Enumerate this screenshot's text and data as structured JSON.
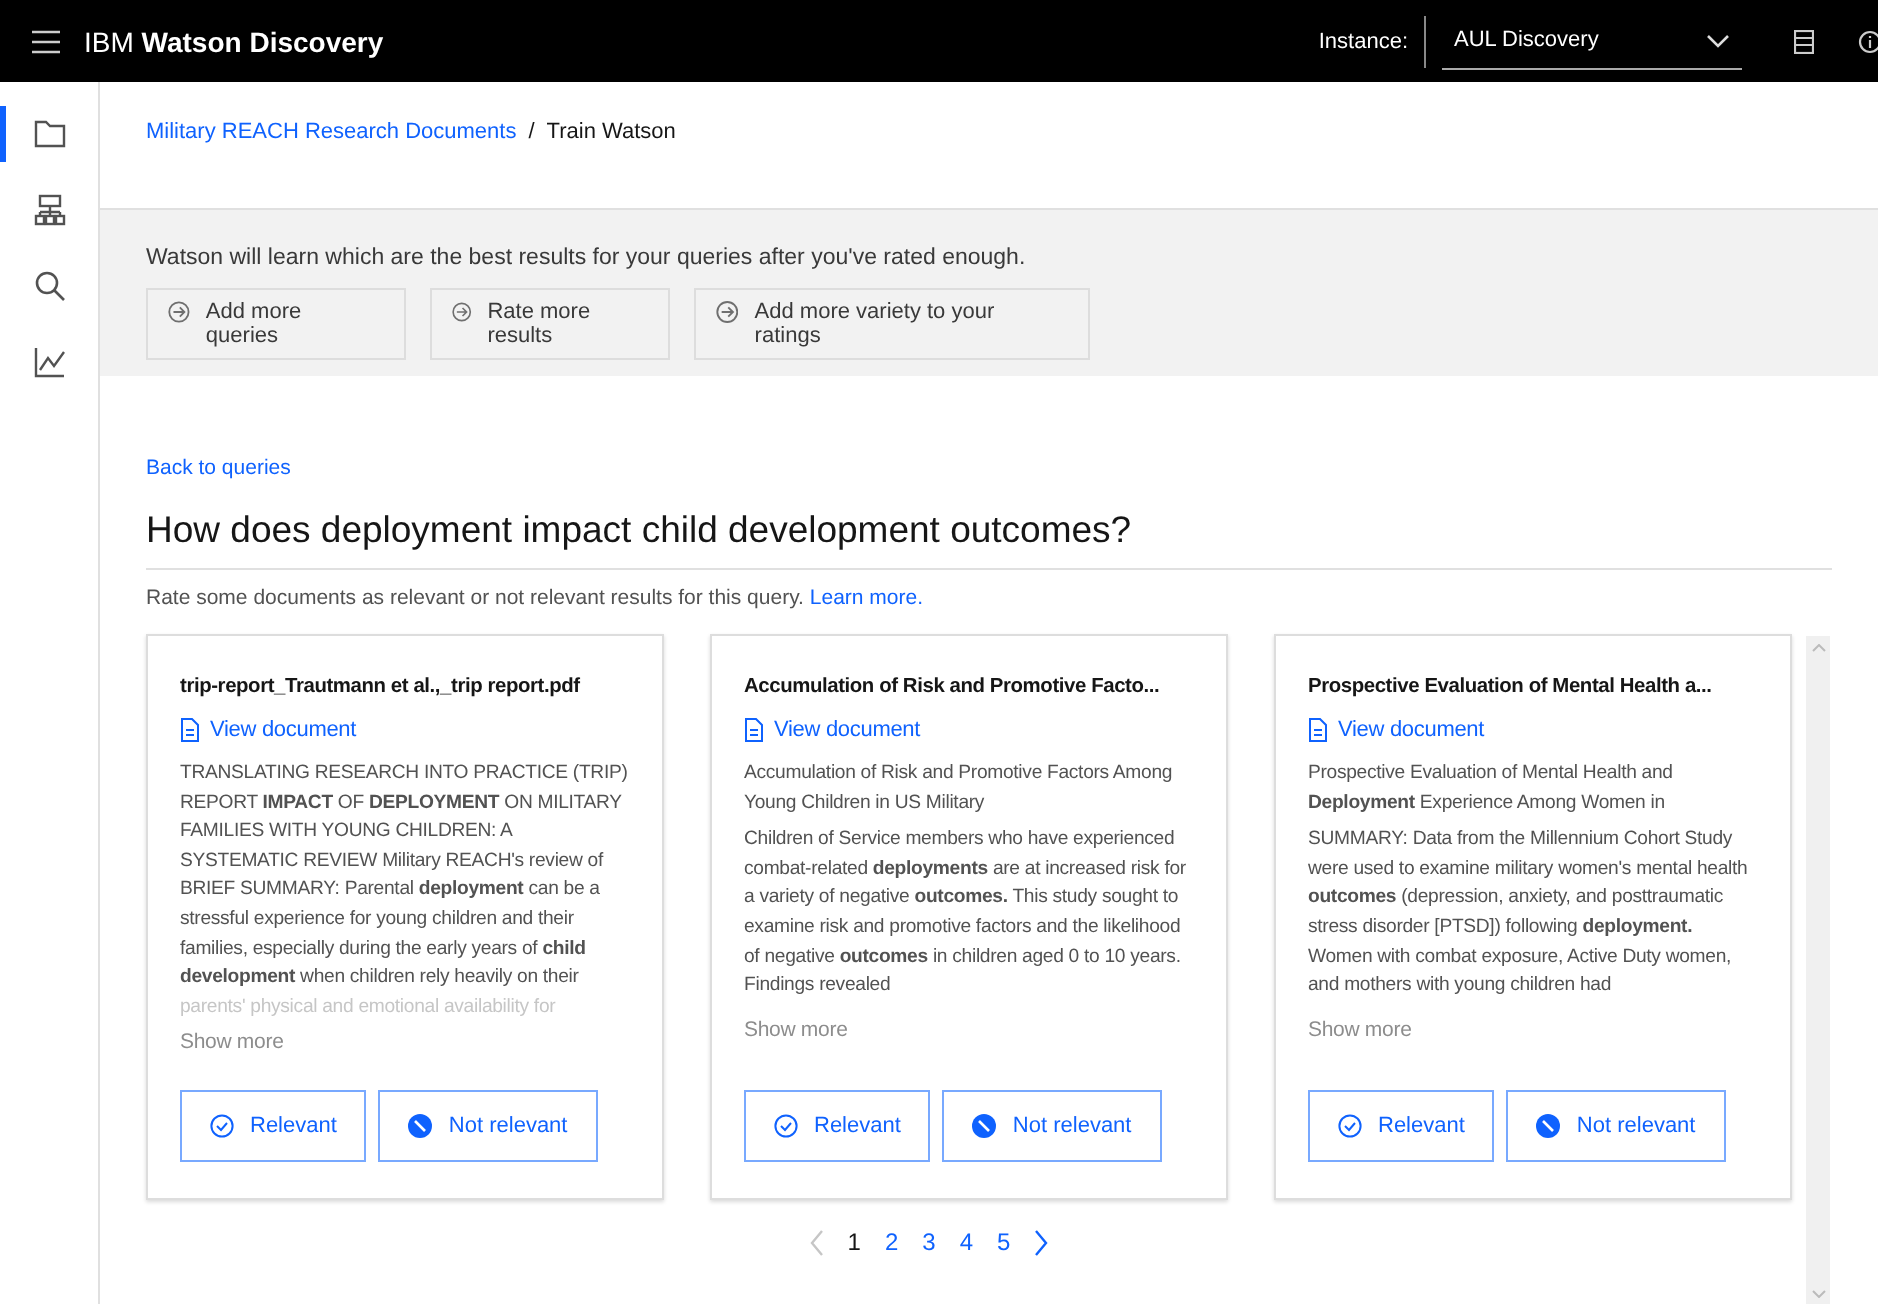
{
  "topbar": {
    "title": "IBM **Watson Discovery**",
    "instance_label": "Instance:",
    "instance_value": "AUL Discovery"
  },
  "rail": {
    "items": [
      {
        "kind": "folder",
        "selected": true
      },
      {
        "kind": "hierarchy",
        "selected": false
      },
      {
        "kind": "search",
        "selected": false
      },
      {
        "kind": "chart",
        "selected": false
      }
    ]
  },
  "breadcrumb": {
    "link": "Military REACH Research Documents",
    "separator": "/",
    "current": "Train Watson"
  },
  "banner": {
    "text": "Watson will learn which are the best results for your queries after you've rated enough.",
    "actions": [
      "Add more queries",
      "Rate more results",
      "Add more variety to your ratings"
    ]
  },
  "back_link": "Back to queries",
  "query": "How does deployment impact child development outcomes?",
  "instructions": {
    "text": "Rate some documents as relevant or not relevant results for this query.",
    "link": "Learn more."
  },
  "cards": [
    {
      "title": "trip-report_Trautmann et al.,_trip report.pdf",
      "link": "View document",
      "paragraphs": [
        "TRANSLATING RESEARCH INTO PRACTICE (TRIP) REPORT **IMPACT** OF **DEPLOYMENT** ON MILITARY FAMILIES WITH YOUNG CHILDREN: A SYSTEMATIC REVIEW Military REACH's review of BRIEF SUMMARY: Parental **deployment** can be a stressful experience for young children and their families, especially during the early years of **child development** when children rely heavily on their"
      ],
      "faded": "parents' physical and emotional availability for",
      "show_more": "Show more",
      "relevant": "Relevant",
      "not_relevant": "Not relevant"
    },
    {
      "title": "Accumulation of Risk and Promotive Facto...",
      "link": "View document",
      "paragraphs": [
        "Accumulation of Risk and Promotive Factors Among Young Children in US Military",
        "Children of Service members who have experienced combat-related **deployments** are at increased risk for a variety of negative **outcomes.** This study sought to examine risk and promotive factors and the likelihood of negative **outcomes** in children aged 0 to 10 years. Findings revealed"
      ],
      "show_more": "Show more",
      "relevant": "Relevant",
      "not_relevant": "Not relevant"
    },
    {
      "title": "Prospective Evaluation of Mental Health a...",
      "link": "View document",
      "paragraphs": [
        "Prospective Evaluation of Mental Health and **Deployment** Experience Among Women in",
        "SUMMARY: Data from the Millennium Cohort Study were used to examine military women's mental health **outcomes** (depression, anxiety, and posttraumatic stress disorder [PTSD]) following **deployment.** Women with combat exposure, Active Duty women, and mothers with young children had"
      ],
      "show_more": "Show more",
      "relevant": "Relevant",
      "not_relevant": "Not relevant"
    }
  ],
  "pagination": {
    "prev_disabled": true,
    "pages": [
      {
        "label": "1",
        "selected": true
      },
      {
        "label": "2",
        "selected": false
      },
      {
        "label": "3",
        "selected": false
      },
      {
        "label": "4",
        "selected": false
      },
      {
        "label": "5",
        "selected": false
      }
    ]
  }
}
